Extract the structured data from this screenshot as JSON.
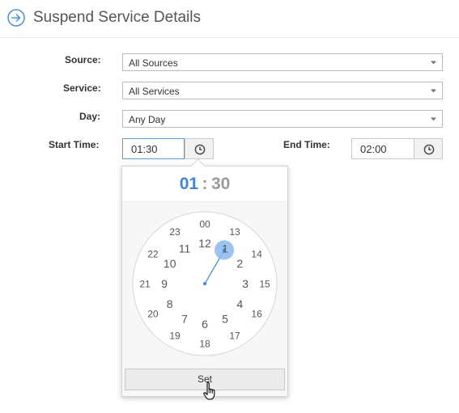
{
  "header": {
    "title": "Suspend Service Details",
    "icon": "arrow-circle-right-icon",
    "accent": "#4a90d9"
  },
  "form": {
    "source": {
      "label": "Source:",
      "value": "All Sources"
    },
    "service": {
      "label": "Service:",
      "value": "All Services"
    },
    "day": {
      "label": "Day:",
      "value": "Any Day"
    },
    "start_time": {
      "label": "Start Time:",
      "value": "01:30"
    },
    "end_time": {
      "label": "End Time:",
      "value": "02:00"
    }
  },
  "clock_picker": {
    "hours": "01",
    "separator": ":",
    "minutes": "30",
    "outer_hours": [
      "00",
      "13",
      "14",
      "15",
      "16",
      "17",
      "18",
      "19",
      "20",
      "21",
      "22",
      "23"
    ],
    "inner_hours": [
      "12",
      "1",
      "2",
      "3",
      "4",
      "5",
      "6",
      "7",
      "8",
      "9",
      "10",
      "11"
    ],
    "selected_hour": "1",
    "set_label": "Set",
    "highlight_color": "#3e86d8"
  }
}
